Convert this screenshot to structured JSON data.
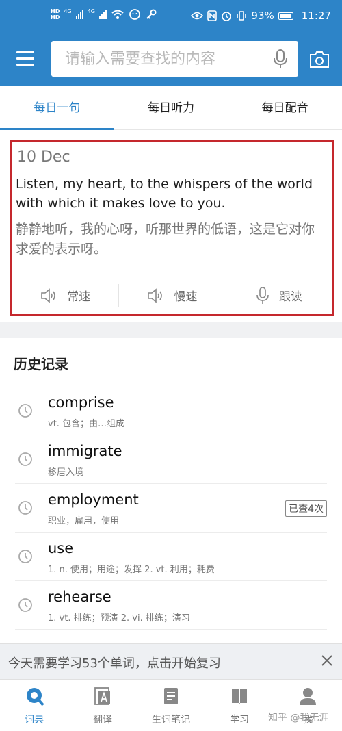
{
  "status_bar": {
    "net_hd_top": "HD",
    "net_hd_bottom": "HD",
    "signal1": "4G",
    "signal2": "4G",
    "battery": "93%",
    "time": "11:27"
  },
  "header": {
    "search_placeholder": "请输入需要查找的内容"
  },
  "tabs": [
    {
      "label": "每日一句",
      "active": true
    },
    {
      "label": "每日听力",
      "active": false
    },
    {
      "label": "每日配音",
      "active": false
    }
  ],
  "daily": {
    "date": "10 Dec",
    "english": "Listen, my heart, to the whispers of the world with which it makes love to you.",
    "chinese": "静静地听，我的心呀，听那世界的低语，这是它对你求爱的表示呀。",
    "actions": [
      {
        "label": "常速",
        "icon": "speaker-icon"
      },
      {
        "label": "慢速",
        "icon": "speaker-icon"
      },
      {
        "label": "跟读",
        "icon": "mic-icon"
      }
    ]
  },
  "history": {
    "title": "历史记录",
    "items": [
      {
        "word": "comprise",
        "definition": "vt. 包含；由…组成",
        "badge": ""
      },
      {
        "word": "immigrate",
        "definition": "移居入境",
        "badge": ""
      },
      {
        "word": "employment",
        "definition": "职业，雇用，使用",
        "badge": "已查4次"
      },
      {
        "word": "use",
        "definition": "1. n. 使用；用途；发挥 2. vt. 利用；耗费",
        "badge": ""
      },
      {
        "word": "rehearse",
        "definition": "1. vt. 排练；预演 2. vi. 排练；演习",
        "badge": ""
      }
    ]
  },
  "reminder": {
    "text": "今天需要学习53个单词，点击开始复习"
  },
  "bottom_nav": [
    {
      "label": "词典",
      "icon": "search-icon",
      "active": true
    },
    {
      "label": "翻译",
      "icon": "translate-icon",
      "active": false
    },
    {
      "label": "生词笔记",
      "icon": "notes-icon",
      "active": false
    },
    {
      "label": "学习",
      "icon": "book-icon",
      "active": false
    },
    {
      "label": "我",
      "icon": "user-icon",
      "active": false
    }
  ],
  "watermark": "知乎 @我无涯",
  "colors": {
    "brand": "#2d84c8",
    "highlight_border": "#c5282d"
  }
}
